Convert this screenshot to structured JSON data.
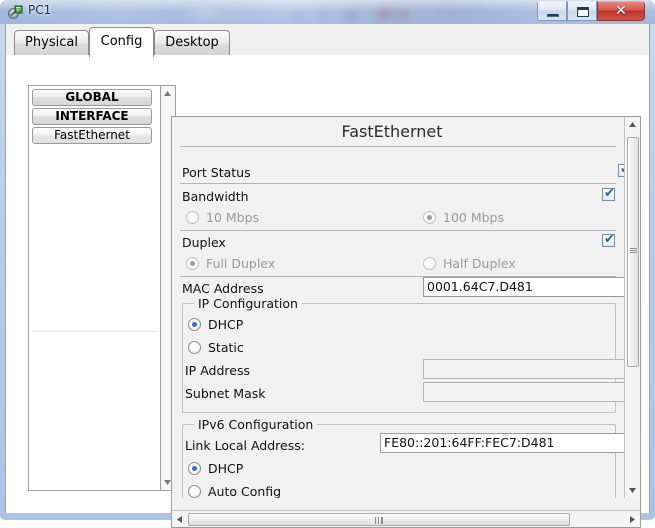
{
  "window": {
    "title": "PC1",
    "icon": "packet-tracer-device-icon",
    "buttons": {
      "minimize": "minimize-icon",
      "maximize": "restore-icon",
      "close": "✕"
    }
  },
  "tabs": [
    {
      "label": "Physical",
      "active": false
    },
    {
      "label": "Config",
      "active": true
    },
    {
      "label": "Desktop",
      "active": false
    }
  ],
  "sidebar": {
    "items": [
      {
        "label": "GLOBAL",
        "type": "header"
      },
      {
        "label": "INTERFACE",
        "type": "header"
      },
      {
        "label": "FastEthernet",
        "type": "item"
      }
    ]
  },
  "main": {
    "title": "FastEthernet",
    "port_status": {
      "label": "Port Status",
      "checked": true
    },
    "bandwidth": {
      "label": "Bandwidth",
      "checked": true,
      "options": [
        {
          "label": "10 Mbps",
          "selected": false,
          "disabled": true
        },
        {
          "label": "100 Mbps",
          "selected": true,
          "disabled": true
        }
      ]
    },
    "duplex": {
      "label": "Duplex",
      "checked": true,
      "options": [
        {
          "label": "Full Duplex",
          "selected": true,
          "disabled": true
        },
        {
          "label": "Half Duplex",
          "selected": false,
          "disabled": true
        }
      ]
    },
    "mac": {
      "label": "MAC Address",
      "value": "0001.64C7.D481"
    },
    "ip_configuration": {
      "title": "IP Configuration",
      "options": [
        {
          "label": "DHCP",
          "selected": true
        },
        {
          "label": "Static",
          "selected": false
        }
      ],
      "fields": [
        {
          "label": "IP Address",
          "value": ""
        },
        {
          "label": "Subnet Mask",
          "value": ""
        }
      ]
    },
    "ipv6_configuration": {
      "title": "IPv6 Configuration",
      "link_local": {
        "label": "Link Local Address:",
        "value": "FE80::201:64FF:FEC7:D481"
      },
      "options": [
        {
          "label": "DHCP",
          "selected": true
        },
        {
          "label": "Auto Config",
          "selected": false
        }
      ]
    }
  },
  "colors": {
    "accent_blue": "#2f6fc4",
    "close_red": "#b8332a",
    "title_bar": "#a8bede",
    "panel_bg": "#f1f1f1"
  }
}
